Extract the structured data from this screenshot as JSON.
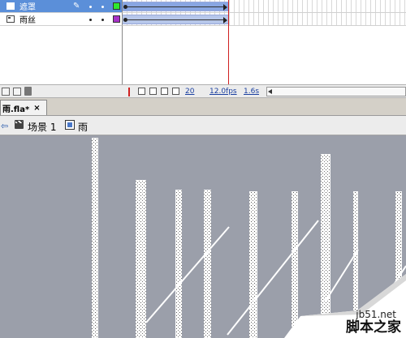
{
  "timeline": {
    "layers": [
      {
        "name": "遮罩",
        "selected": true,
        "swatch_color": "#2ee82e",
        "show_pencil": true
      },
      {
        "name": "雨丝",
        "selected": false,
        "swatch_color": "#a832c8",
        "show_pencil": false
      }
    ],
    "status": {
      "current_frame": "20",
      "fps": "12.0fps",
      "elapsed": "1.6s"
    }
  },
  "document_tab": {
    "title": "雨.fla*",
    "close_glyph": "×"
  },
  "edit_bar": {
    "back_glyph": "⇦",
    "scene_label": "场景 1",
    "symbol_label": "雨"
  },
  "watermark": {
    "site": "jb51.net",
    "name": "脚本之家"
  },
  "colors": {
    "stage_bg": "#9b9faa",
    "selected_layer": "#5b8fd9",
    "playhead": "#d02020"
  }
}
